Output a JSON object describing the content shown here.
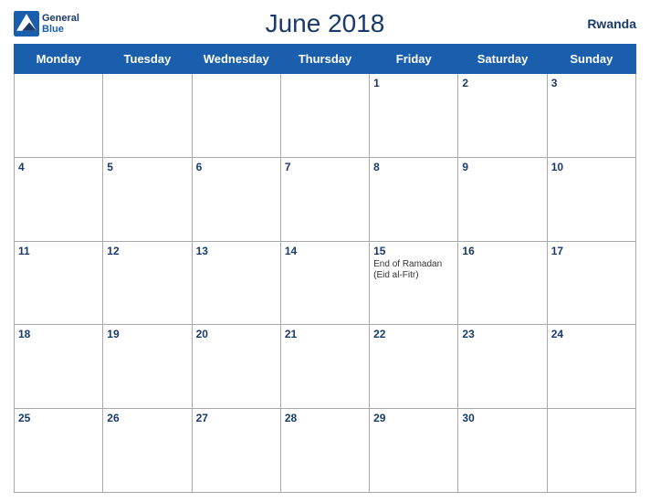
{
  "header": {
    "title": "June 2018",
    "country": "Rwanda",
    "logo": {
      "line1": "General",
      "line2": "Blue"
    }
  },
  "days": [
    "Monday",
    "Tuesday",
    "Wednesday",
    "Thursday",
    "Friday",
    "Saturday",
    "Sunday"
  ],
  "weeks": [
    [
      {
        "date": "",
        "events": []
      },
      {
        "date": "",
        "events": []
      },
      {
        "date": "",
        "events": []
      },
      {
        "date": "",
        "events": []
      },
      {
        "date": "1",
        "events": []
      },
      {
        "date": "2",
        "events": []
      },
      {
        "date": "3",
        "events": []
      }
    ],
    [
      {
        "date": "4",
        "events": []
      },
      {
        "date": "5",
        "events": []
      },
      {
        "date": "6",
        "events": []
      },
      {
        "date": "7",
        "events": []
      },
      {
        "date": "8",
        "events": []
      },
      {
        "date": "9",
        "events": []
      },
      {
        "date": "10",
        "events": []
      }
    ],
    [
      {
        "date": "11",
        "events": []
      },
      {
        "date": "12",
        "events": []
      },
      {
        "date": "13",
        "events": []
      },
      {
        "date": "14",
        "events": []
      },
      {
        "date": "15",
        "events": [
          "End of Ramadan",
          "(Eid al-Fitr)"
        ]
      },
      {
        "date": "16",
        "events": []
      },
      {
        "date": "17",
        "events": []
      }
    ],
    [
      {
        "date": "18",
        "events": []
      },
      {
        "date": "19",
        "events": []
      },
      {
        "date": "20",
        "events": []
      },
      {
        "date": "21",
        "events": []
      },
      {
        "date": "22",
        "events": []
      },
      {
        "date": "23",
        "events": []
      },
      {
        "date": "24",
        "events": []
      }
    ],
    [
      {
        "date": "25",
        "events": []
      },
      {
        "date": "26",
        "events": []
      },
      {
        "date": "27",
        "events": []
      },
      {
        "date": "28",
        "events": []
      },
      {
        "date": "29",
        "events": []
      },
      {
        "date": "30",
        "events": []
      },
      {
        "date": "",
        "events": []
      }
    ]
  ]
}
